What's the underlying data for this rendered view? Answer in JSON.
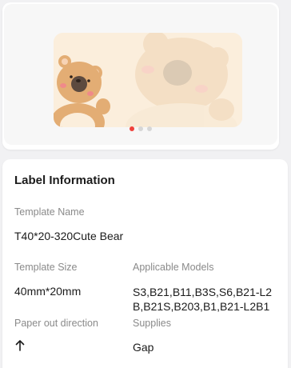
{
  "preview": {
    "image_name": "cute-bear-label",
    "page_count": 3,
    "active_page": 1,
    "colors": {
      "background": "#fbeedc",
      "bear": "#e3ad74",
      "dot_active": "#f0413b",
      "dot_inactive": "#d6d6d6"
    }
  },
  "label_info": {
    "title": "Label Information",
    "template_name_label": "Template Name",
    "template_name": "T40*20-320Cute Bear",
    "template_size_label": "Template Size",
    "template_size": "40mm*20mm",
    "applicable_models_label": "Applicable Models",
    "applicable_models": "S3,B21,B11,B3S,S6,B21-L2B,B21S,B203,B1,B21-L2B1",
    "paper_out_direction_label": "Paper out direction",
    "paper_out_direction_icon": "arrow-up-icon",
    "supplies_label": "Supplies",
    "supplies": "Gap"
  }
}
